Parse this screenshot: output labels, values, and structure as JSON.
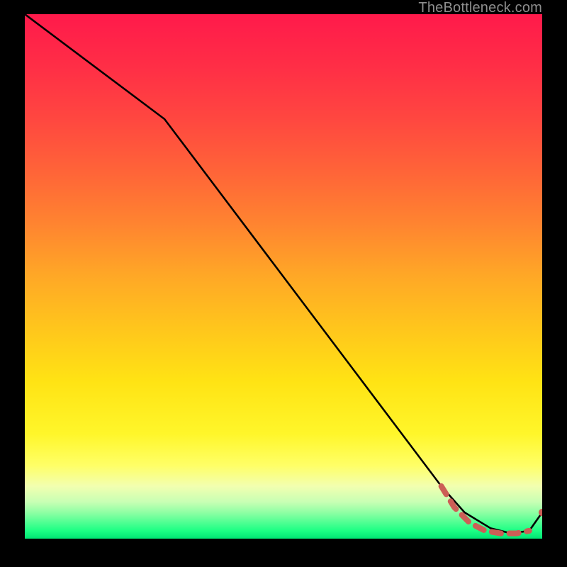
{
  "watermark": "TheBottleneck.com",
  "colors": {
    "bg_black": "#000000",
    "watermark": "#8e8e8e",
    "curve": "#000000",
    "dashed": "#cc5e56",
    "marker": "#cc5e56"
  },
  "chart_data": {
    "type": "line",
    "title": "",
    "xlabel": "",
    "ylabel": "",
    "xlim": [
      0,
      100
    ],
    "ylim": [
      0,
      100
    ],
    "grid": false,
    "legend": false,
    "gradient_stops": [
      {
        "pos": 0.0,
        "color": "#ff1a4b"
      },
      {
        "pos": 0.1,
        "color": "#ff2e46"
      },
      {
        "pos": 0.2,
        "color": "#ff4740"
      },
      {
        "pos": 0.3,
        "color": "#ff6438"
      },
      {
        "pos": 0.4,
        "color": "#ff8430"
      },
      {
        "pos": 0.5,
        "color": "#ffa826"
      },
      {
        "pos": 0.6,
        "color": "#ffc61c"
      },
      {
        "pos": 0.7,
        "color": "#ffe314"
      },
      {
        "pos": 0.8,
        "color": "#fff62a"
      },
      {
        "pos": 0.86,
        "color": "#ffff66"
      },
      {
        "pos": 0.9,
        "color": "#f2ffb0"
      },
      {
        "pos": 0.93,
        "color": "#c8ffb4"
      },
      {
        "pos": 0.95,
        "color": "#8fffa4"
      },
      {
        "pos": 0.97,
        "color": "#4dff92"
      },
      {
        "pos": 0.985,
        "color": "#1cff84"
      },
      {
        "pos": 1.0,
        "color": "#00e574"
      }
    ],
    "series": [
      {
        "name": "bottleneck-curve",
        "style": "solid",
        "color": "#000000",
        "x": [
          0,
          27,
          80.5,
          85,
          90,
          94,
          97.5,
          100
        ],
        "y": [
          100,
          80,
          10,
          5,
          2,
          1,
          1.5,
          5
        ]
      },
      {
        "name": "optimal-range",
        "style": "dashed",
        "color": "#cc5e56",
        "x": [
          80.5,
          83,
          86,
          89,
          92,
          95,
          97.5
        ],
        "y": [
          10,
          6,
          3,
          1.5,
          1,
          1,
          1.5
        ]
      }
    ],
    "markers": [
      {
        "name": "end-marker",
        "x": 100,
        "y": 5,
        "color": "#cc5e56"
      }
    ]
  }
}
